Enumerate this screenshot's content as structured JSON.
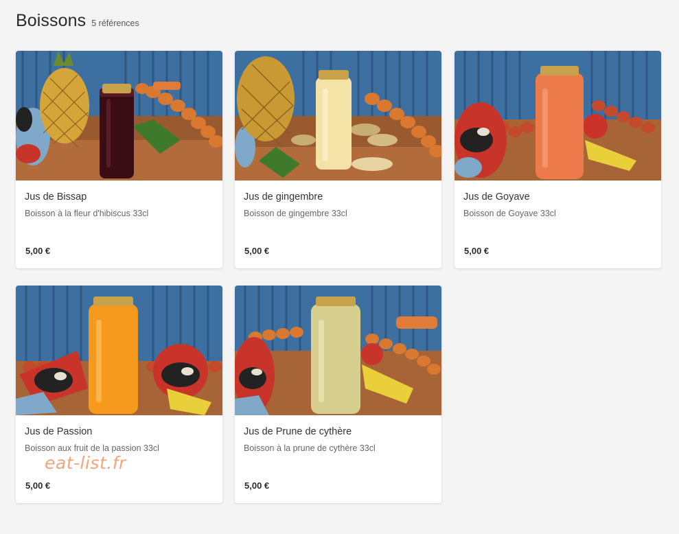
{
  "section": {
    "title": "Boissons",
    "count": "5 références"
  },
  "products": [
    {
      "name": "Jus de Bissap",
      "description": "Boisson à la fleur d'hibiscus 33cl",
      "price": "5,00 €",
      "photo_subject": "bissap-juice-bottle-with-pineapple",
      "juice_color": "#3a0d14"
    },
    {
      "name": "Jus de gingembre",
      "description": "Boisson de gingembre 33cl",
      "price": "5,00 €",
      "photo_subject": "ginger-juice-bottle-with-pineapple-and-ginger",
      "juice_color": "#f3e3a6"
    },
    {
      "name": "Jus de Goyave",
      "description": "Boisson de Goyave 33cl",
      "price": "5,00 €",
      "photo_subject": "guava-juice-bottle-with-masks",
      "juice_color": "#ec7a4a"
    },
    {
      "name": "Jus de Passion",
      "description": "Boisson aux fruit de la passion 33cl",
      "price": "5,00 €",
      "photo_subject": "passion-juice-bottle-with-masks",
      "juice_color": "#f59a1d"
    },
    {
      "name": "Jus de Prune de cythère",
      "description": "Boisson à la prune de cythère 33cl",
      "price": "5,00 €",
      "photo_subject": "cythere-plum-juice-bottle-with-mask",
      "juice_color": "#d6cf8f"
    }
  ],
  "watermark": "eat-list.fr"
}
